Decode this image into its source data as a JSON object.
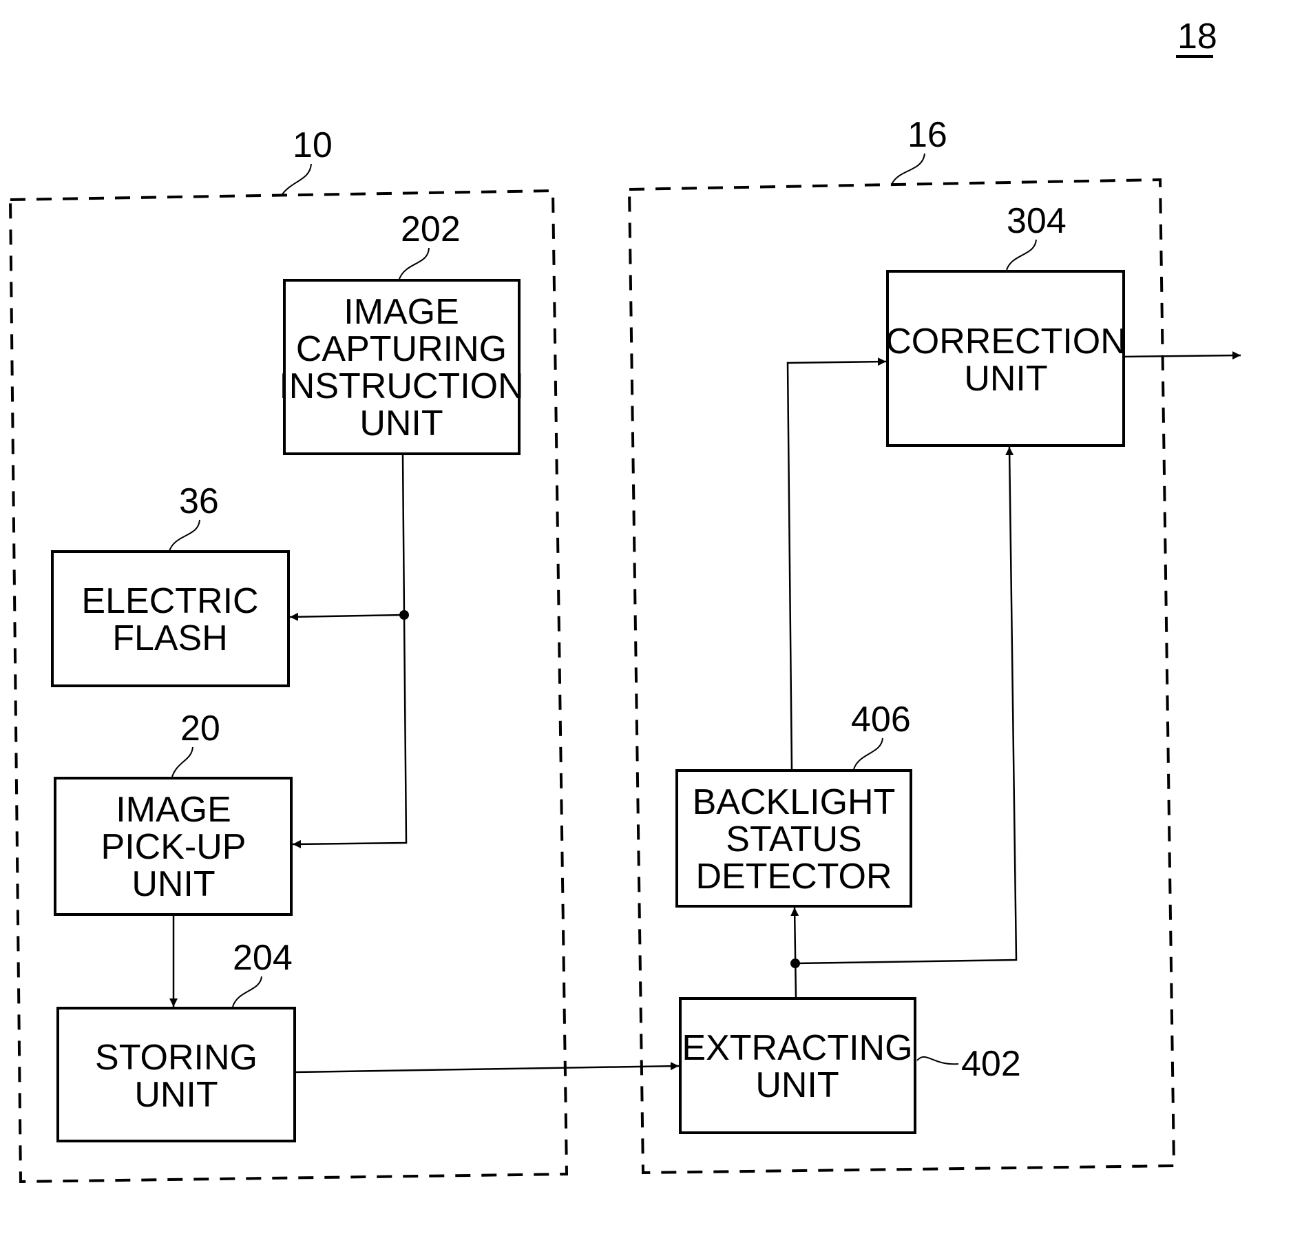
{
  "figure_ref": "18",
  "groups": [
    {
      "ref": "10"
    },
    {
      "ref": "16"
    }
  ],
  "blocks": {
    "capture_instr": {
      "ref": "202",
      "lines": [
        "IMAGE",
        "CAPTURING",
        "INSTRUCTION",
        "UNIT"
      ]
    },
    "flash": {
      "ref": "36",
      "lines": [
        "ELECTRIC",
        "FLASH"
      ]
    },
    "pickup": {
      "ref": "20",
      "lines": [
        "IMAGE",
        "PICK-UP",
        "UNIT"
      ]
    },
    "storing": {
      "ref": "204",
      "lines": [
        "STORING",
        "UNIT"
      ]
    },
    "correction": {
      "ref": "304",
      "lines": [
        "CORRECTION",
        "UNIT"
      ]
    },
    "backlight": {
      "ref": "406",
      "lines": [
        "BACKLIGHT",
        "STATUS",
        "DETECTOR"
      ]
    },
    "extracting": {
      "ref": "402",
      "lines": [
        "EXTRACTING",
        "UNIT"
      ]
    }
  },
  "connections": [
    {
      "from": "202",
      "to": "36"
    },
    {
      "from": "202",
      "to": "20"
    },
    {
      "from": "20",
      "to": "204"
    },
    {
      "from": "204",
      "to": "402"
    },
    {
      "from": "402",
      "to": "406"
    },
    {
      "from": "402",
      "to": "304"
    },
    {
      "from": "406",
      "to": "304"
    },
    {
      "from": "304",
      "to": "output"
    }
  ]
}
